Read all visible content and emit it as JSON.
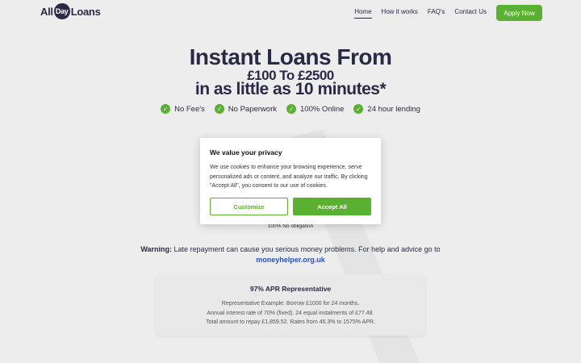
{
  "brand": {
    "logo_left": "All",
    "logo_mid": "Day",
    "logo_right": "Loans",
    "accent_color": "#5ab031",
    "navy_color": "#2a2a46"
  },
  "nav": {
    "items": [
      {
        "label": "Home",
        "active": true
      },
      {
        "label": "How it works",
        "active": false
      },
      {
        "label": "FAQ's",
        "active": false
      },
      {
        "label": "Contact Us",
        "active": false
      }
    ],
    "apply_label": "Apply Now"
  },
  "hero": {
    "line1": "Instant Loans From",
    "line2": "£100 To £2500",
    "line3": "in as little as 10 minutes*",
    "features": [
      {
        "icon": "check-circle-icon",
        "label": "No Fee's"
      },
      {
        "icon": "check-circle-icon",
        "label": "No Paperwork"
      },
      {
        "icon": "check-circle-icon",
        "label": "100% Online"
      },
      {
        "icon": "check-circle-icon",
        "label": "24 hour lending"
      }
    ]
  },
  "form": {
    "obligation_text": "100% No obligation"
  },
  "warning": {
    "label": "Warning:",
    "text": " Late repayment can cause you serious money problems. For help and advice go to",
    "link": "moneyhelper.org.uk"
  },
  "apr": {
    "title": "97% APR Representative",
    "line1": "Representative Example: Borrow £1000 for 24 months.",
    "line2": "Annual interest rate of 70% (fixed). 24 equal instalments of £77.48.",
    "line3": "Total amount to repay £1,859.52. Rates from 45.3% to 1575% APR."
  },
  "cookie": {
    "title": "We value your privacy",
    "body": "We use cookies to enhance your browsing experience, serve personalized ads or content, and analyze our traffic. By clicking \"Accept All\", you consent to our use of cookies.",
    "customize_label": "Customize",
    "accept_label": "Accept All"
  }
}
